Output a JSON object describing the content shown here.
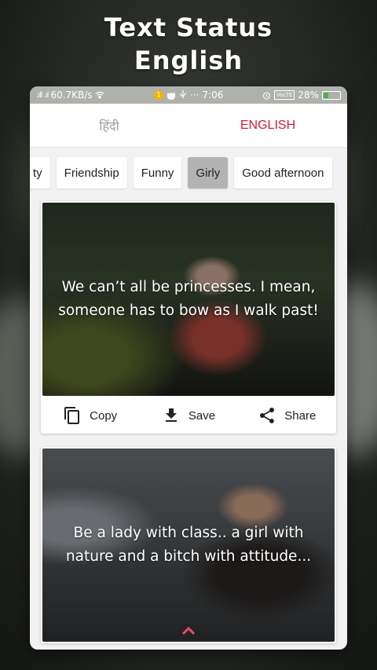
{
  "promo": {
    "title_line1": "Text Status",
    "title_line2": "English"
  },
  "statusbar": {
    "signal": ".ıll .ıl",
    "speed": "60.7KB/s",
    "time": "7:06",
    "dots": "···",
    "volte": "VoLTE",
    "battery": "28%",
    "battery_level": 0.28
  },
  "tabs": {
    "hindi": "हिंदी",
    "english": "ENGLISH",
    "active": "english"
  },
  "colors": {
    "accent": "#d81b3b",
    "chip_selected": "#b3b3b3"
  },
  "categories": [
    "ty",
    "Friendship",
    "Funny",
    "Girly",
    "Good afternoon"
  ],
  "selected_category": "Girly",
  "cards": [
    {
      "quote": "We can’t all be princesses. I mean, someone has to bow as I walk past!",
      "actions": {
        "copy": "Copy",
        "save": "Save",
        "share": "Share"
      }
    },
    {
      "quote": "Be a lady with class.. a girl with nature and a bitch with attitude..."
    }
  ],
  "icons": [
    "wifi-icon",
    "notification-badge-icon",
    "cat-icon",
    "usb-icon",
    "alarm-icon",
    "battery-icon",
    "copy-icon",
    "download-icon",
    "share-icon",
    "chevron-up-icon"
  ]
}
